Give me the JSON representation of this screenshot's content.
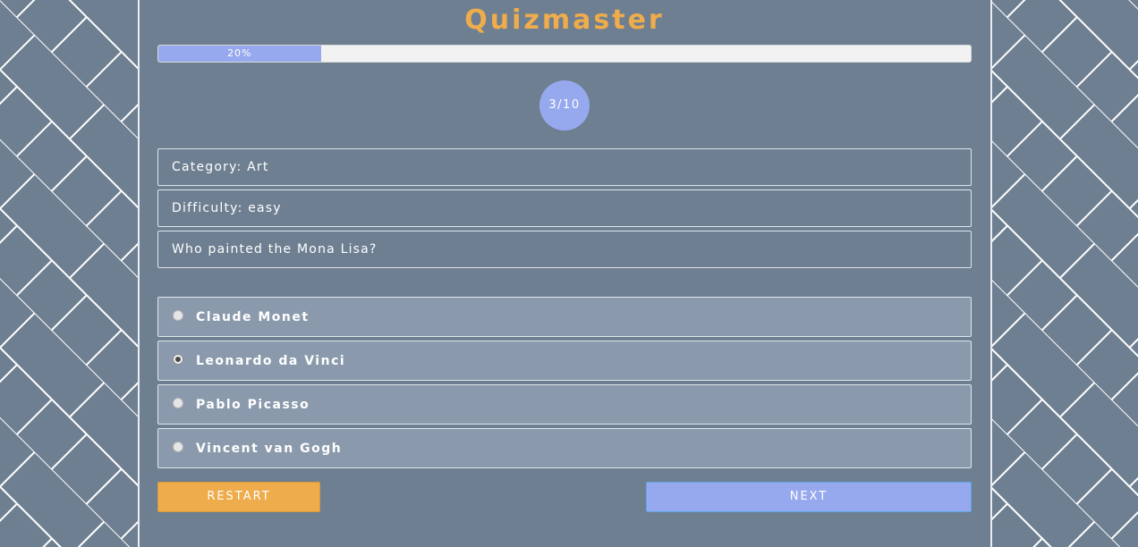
{
  "app": {
    "title": "Quizmaster"
  },
  "progress": {
    "percent_label": "20%",
    "fraction": 0.2
  },
  "counter": {
    "label": "3/10"
  },
  "question": {
    "category": "Category: Art",
    "difficulty": "Difficulty: easy",
    "text": "Who painted the Mona Lisa?"
  },
  "answers": [
    {
      "label": "Claude Monet",
      "selected": false
    },
    {
      "label": "Leonardo da Vinci",
      "selected": true
    },
    {
      "label": "Pablo Picasso",
      "selected": false
    },
    {
      "label": "Vincent van Gogh",
      "selected": false
    }
  ],
  "buttons": {
    "restart": "RESTART",
    "next": "NEXT"
  },
  "colors": {
    "accent_orange": "#eeac4c",
    "accent_blue": "#97a9ee",
    "background": "#6e7f91",
    "answer_background": "#8a9aac"
  }
}
